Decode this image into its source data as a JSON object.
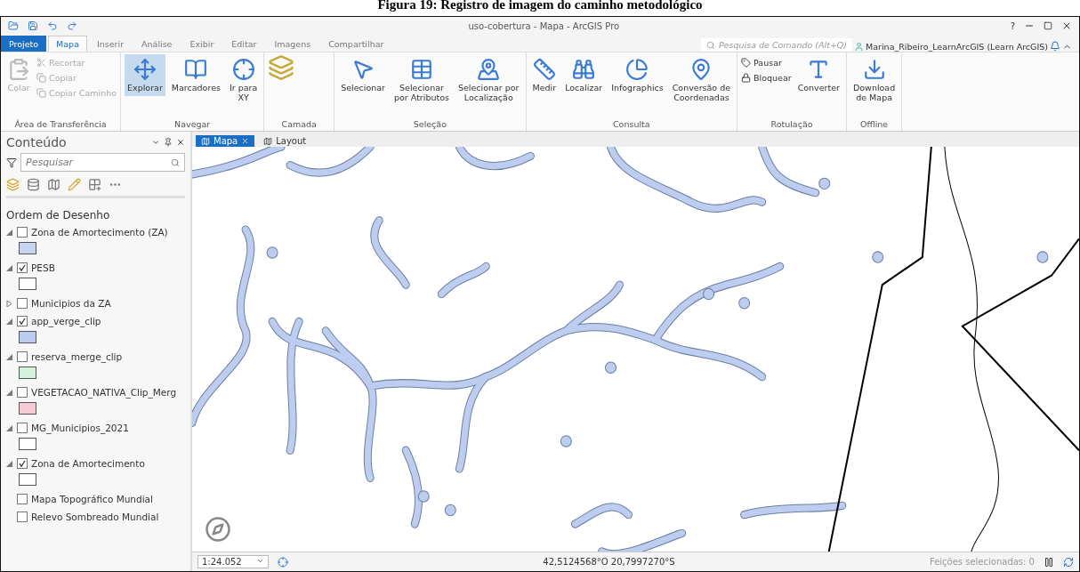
{
  "caption": "Figura 19: Registro de imagem do caminho metodológico",
  "window": {
    "title": "uso-cobertura - Mapa - ArcGIS Pro",
    "help": "?"
  },
  "tabs": [
    {
      "label": "Projeto",
      "kind": "backstage",
      "selected": false
    },
    {
      "label": "Mapa",
      "kind": "tab",
      "selected": true
    },
    {
      "label": "Inserir",
      "kind": "tab",
      "selected": false
    },
    {
      "label": "Análise",
      "kind": "tab",
      "selected": false
    },
    {
      "label": "Exibir",
      "kind": "tab",
      "selected": false
    },
    {
      "label": "Editar",
      "kind": "tab",
      "selected": false
    },
    {
      "label": "Imagens",
      "kind": "tab",
      "selected": false
    },
    {
      "label": "Compartilhar",
      "kind": "tab",
      "selected": false
    }
  ],
  "command_search": {
    "placeholder": "Pesquisa de Comando (Alt+Q)"
  },
  "user": "Marina_Ribeiro_LearnArcGIS (Learn ArcGIS)",
  "ribbon": [
    {
      "label": "Área de Transferência",
      "tools": [
        {
          "label": "Colar",
          "kind": "large",
          "disabled": true
        },
        {
          "label": "Recortar",
          "kind": "small",
          "disabled": true
        },
        {
          "label": "Copiar",
          "kind": "small",
          "disabled": true
        },
        {
          "label": "Copiar Caminho",
          "kind": "small",
          "disabled": true
        }
      ]
    },
    {
      "label": "Navegar",
      "tools": [
        {
          "label": "Explorar",
          "kind": "large",
          "disabled": false,
          "selected": true
        },
        {
          "label": "Marcadores",
          "kind": "large",
          "disabled": false,
          "selected": false
        },
        {
          "label": "Ir para\nXY",
          "kind": "large",
          "disabled": false,
          "selected": false
        }
      ]
    },
    {
      "label": "Camada"
    },
    {
      "label": "Seleção",
      "tools": [
        {
          "label": "Selecionar",
          "kind": "large",
          "disabled": false
        },
        {
          "label": "Selecionar\npor Atributos",
          "kind": "large",
          "disabled": false
        },
        {
          "label": "Selecionar por\nLocalização",
          "kind": "large",
          "disabled": false
        }
      ]
    },
    {
      "label": "Consulta",
      "tools": [
        {
          "label": "Medir",
          "kind": "large",
          "disabled": false
        },
        {
          "label": "Localizar",
          "kind": "large",
          "disabled": false
        },
        {
          "label": "Infographics",
          "kind": "large",
          "disabled": false
        },
        {
          "label": "Conversão de\nCoordenadas",
          "kind": "large",
          "disabled": false
        }
      ]
    },
    {
      "label": "Rotulação",
      "tools": [
        {
          "label": "Pausar",
          "kind": "small",
          "disabled": false
        },
        {
          "label": "Bloquear",
          "kind": "small",
          "disabled": false
        },
        {
          "label": "Converter",
          "kind": "large",
          "disabled": false
        }
      ]
    },
    {
      "label": "Offline",
      "tools": [
        {
          "label": "Download\nde Mapa",
          "kind": "large",
          "disabled": false
        }
      ]
    }
  ],
  "contents": {
    "title": "Conteúdo",
    "search": {
      "placeholder": "Pesquisar"
    },
    "heading": "Ordem de Desenho",
    "layers": [
      {
        "name": "Zona de Amortecimento (ZA)",
        "kind": "layer",
        "expanded": true,
        "checked": false,
        "color": "#c9d6f2"
      },
      {
        "name": "PESB",
        "kind": "layer",
        "expanded": true,
        "checked": true,
        "color": "#ffffff"
      },
      {
        "name": "Municipios da ZA",
        "kind": "layer",
        "expanded": false,
        "checked": false
      },
      {
        "name": "app_verge_clip",
        "kind": "layer",
        "expanded": true,
        "checked": true,
        "color": "#bccdf0"
      },
      {
        "name": "reserva_merge_clip",
        "kind": "layer",
        "expanded": true,
        "checked": false,
        "color": "#d3f3dc"
      },
      {
        "name": "VEGETACAO_NATIVA_Clip_Merg",
        "kind": "layer",
        "expanded": true,
        "checked": false,
        "color": "#f6cbd6"
      },
      {
        "name": "MG_Municipios_2021",
        "kind": "layer",
        "expanded": true,
        "checked": false,
        "color": "#ffffff"
      },
      {
        "name": "Zona de Amortecimento",
        "kind": "layer",
        "expanded": true,
        "checked": true,
        "color": "#ffffff"
      },
      {
        "name": "Mapa Topográfico Mundial",
        "kind": "basemap",
        "checked": false
      },
      {
        "name": "Relevo Sombreado Mundial",
        "kind": "basemap",
        "checked": false
      }
    ]
  },
  "views": [
    {
      "label": "Mapa",
      "selected": true
    },
    {
      "label": "Layout",
      "selected": false
    }
  ],
  "status_bar": {
    "scale": "1:24.052",
    "coordinates": "42,5124568°O 20,7997270°S",
    "selection": "Feições selecionadas: 0"
  }
}
